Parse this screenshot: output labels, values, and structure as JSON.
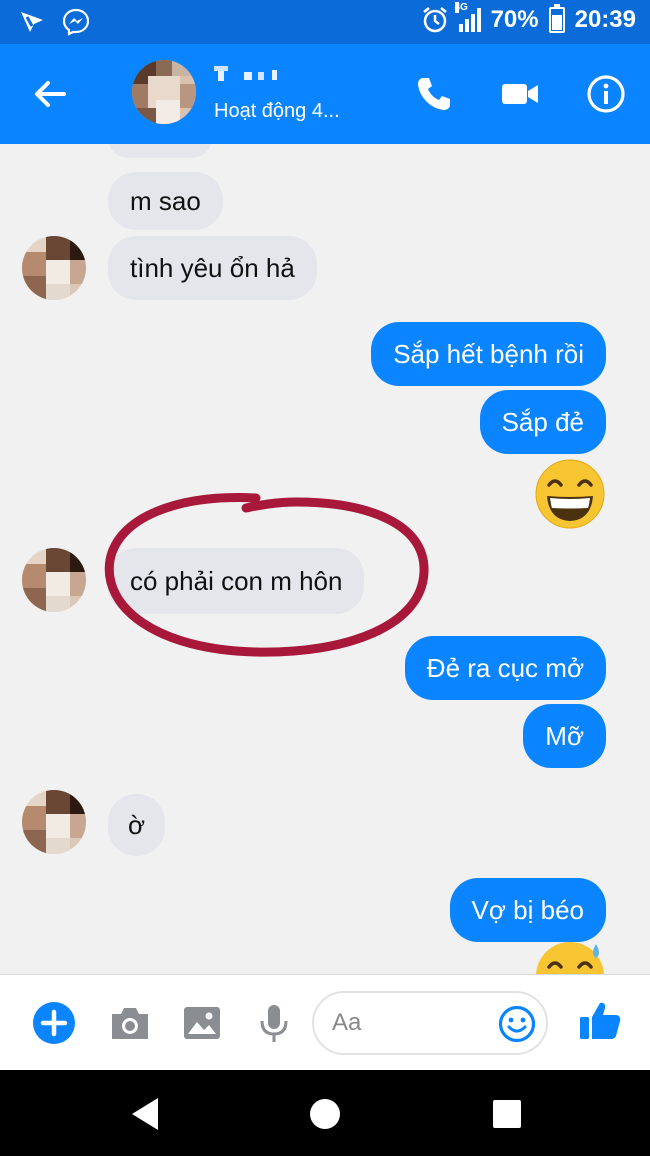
{
  "status_bar": {
    "network": "4G",
    "battery_level": 0.7,
    "battery": "70%",
    "time": "20:39",
    "icons": [
      "app-notification-icon",
      "messenger-icon",
      "alarm-icon",
      "signal-icon",
      "battery-icon"
    ]
  },
  "header": {
    "name": "",
    "status": "Hoạt động 4...",
    "actions": [
      "back-arrow-icon",
      "phone-icon",
      "video-camera-icon",
      "info-icon"
    ]
  },
  "messages": [
    {
      "from": "them",
      "text": "m sao"
    },
    {
      "from": "them",
      "text": "tình yêu ổn hả"
    },
    {
      "from": "me",
      "text": "Sắp hết bệnh rồi"
    },
    {
      "from": "me",
      "text": "Sắp đẻ"
    },
    {
      "from": "me",
      "emoji": "grinning-emoji"
    },
    {
      "from": "them",
      "text": "có phải con m hôn",
      "highlighted": true
    },
    {
      "from": "me",
      "text": "Đẻ ra cục mở"
    },
    {
      "from": "me",
      "text": "Mỡ"
    },
    {
      "from": "them",
      "text": "ờ"
    },
    {
      "from": "me",
      "text": "Vợ bị béo"
    },
    {
      "from": "me",
      "emoji": "grinning-sweat-emoji"
    }
  ],
  "composer": {
    "placeholder": "Aa",
    "icons": [
      "plus-icon",
      "camera-icon",
      "image-icon",
      "microphone-icon",
      "emoji-icon",
      "thumbs-up-icon"
    ]
  },
  "colors": {
    "status_bar": "#0a6bd9",
    "header": "#0a84ff",
    "outgoing_bubble": "#0a84ff",
    "incoming_bubble": "#e4e6eb",
    "highlight_circle": "#a8183a"
  }
}
